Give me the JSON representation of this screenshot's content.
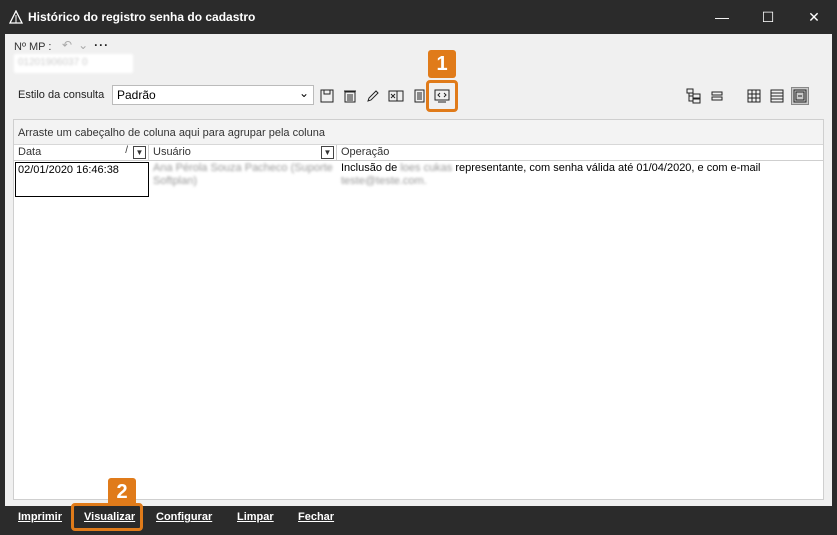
{
  "window": {
    "title": "Histórico do registro senha do cadastro",
    "minimize_glyph": "—",
    "maximize_glyph": "☐",
    "close_glyph": "✕"
  },
  "header": {
    "mp_label": "Nº MP :",
    "mp_value": "01201906037 0",
    "undo_glyph": "↶",
    "dropdown_glyph": "⌄",
    "more_glyph": "···"
  },
  "toolbar": {
    "style_label": "Estilo da consulta",
    "style_value": "Padrão",
    "icons": [
      "save-icon",
      "delete-icon",
      "edit-icon",
      "excel-export-icon",
      "copy-icon",
      "history-view-icon"
    ],
    "right_icons": [
      "tree-layout-icon",
      "group-rows-icon",
      "grid-view-icon",
      "list-view-icon",
      "card-view-icon"
    ]
  },
  "grid": {
    "group_hint": "Arraste um cabeçalho de coluna aqui para agrupar pela coluna",
    "columns": [
      "Data",
      "Usuário",
      "Operação"
    ],
    "sort_glyph": "/",
    "filter_glyph": "▼",
    "rows": [
      {
        "date": "02/01/2020 16:46:38",
        "user": "Ana Pérola Souza Pacheco (Suporte Softplan)",
        "op_prefix": "Inclusão de",
        "op_hidden": "loes cukas",
        "op_suffix": "representante, com senha válida até 01/04/2020, e com e-mail",
        "op_email": "teste@teste.com."
      }
    ]
  },
  "bottom": {
    "print": "Imprimir",
    "view": "Visualizar",
    "configure": "Configurar",
    "clear": "Limpar",
    "close": "Fechar"
  },
  "annotations": {
    "badge1": "1",
    "badge2": "2",
    "color": "#e07b1a"
  }
}
